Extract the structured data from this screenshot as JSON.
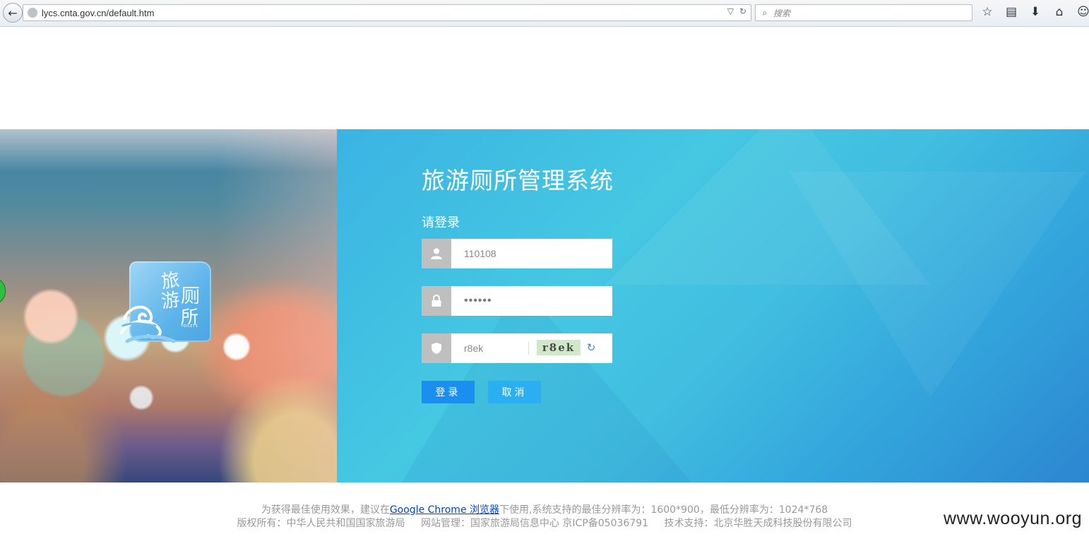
{
  "browser": {
    "url": "lycs.cnta.gov.cn/default.htm",
    "search_placeholder": "搜索"
  },
  "app": {
    "title": "旅游厕所管理系统",
    "login_prompt": "请登录",
    "logo_chars": [
      "旅",
      "游",
      "厕",
      "所"
    ],
    "logo_sub": "TOILETS"
  },
  "form": {
    "username_value": "110108",
    "password_value": "••••••",
    "captcha_value": "r8ek",
    "captcha_image_text": "r8ek",
    "login_label": "登录",
    "cancel_label": "取消"
  },
  "footer": {
    "line1_pre": "为获得最佳使用效果，建议在",
    "line1_link": "Google Chrome 浏览器",
    "line1_post": "下使用,系统支持的最佳分辨率为：1600*900，最低分辨率为：1024*768",
    "copyright": "版权所有：中华人民共和国国家旅游局",
    "management": "网站管理：国家旅游局信息中心 京ICP备05036791",
    "tech_support": "技术支持：北京华胜天成科技股份有限公司"
  },
  "watermark": "www.wooyun.org",
  "colors": {
    "login_button": "#1a8ff0",
    "cancel_button": "#2ab0f2",
    "panel_blue": "#41bde0"
  }
}
